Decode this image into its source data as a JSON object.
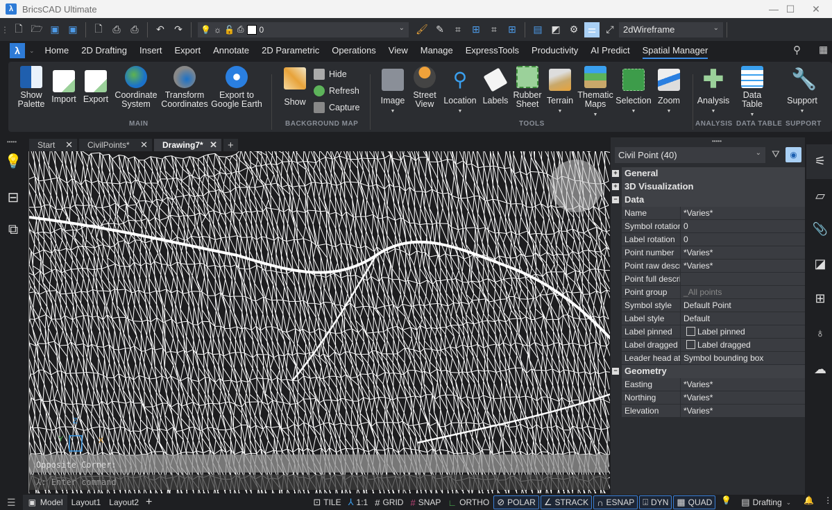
{
  "window": {
    "title": "BricsCAD Ultimate",
    "minimize": "—",
    "maximize": "☐",
    "close": "✕"
  },
  "qat": {
    "layer_value": "0",
    "visual_style": "2dWireframe"
  },
  "menu": {
    "app_button": "λ",
    "items": [
      "Home",
      "2D Drafting",
      "Insert",
      "Export",
      "Annotate",
      "2D Parametric",
      "Operations",
      "View",
      "Manage",
      "ExpressTools",
      "Productivity",
      "AI Predict",
      "Spatial Manager"
    ],
    "active": "Spatial Manager"
  },
  "ribbon": {
    "main": [
      {
        "label": "Show\nPalette",
        "icon": "spm-palette-icon"
      },
      {
        "label": "Import",
        "icon": "import-icon"
      },
      {
        "label": "Export",
        "icon": "export-icon"
      },
      {
        "label": "Coordinate\nSystem",
        "icon": "globe-icon"
      },
      {
        "label": "Transform\nCoordinates",
        "icon": "transform-globe-icon"
      },
      {
        "label": "Export to\nGoogle Earth",
        "icon": "google-earth-icon"
      }
    ],
    "background_map": {
      "show": "Show",
      "hide": "Hide",
      "refresh": "Refresh",
      "capture": "Capture"
    },
    "tools": [
      "Image",
      "Street\nView",
      "Location",
      "Labels",
      "Rubber\nSheet",
      "Terrain",
      "Thematic\nMaps",
      "Selection",
      "Zoom"
    ],
    "analysis": "Analysis",
    "data_table": "Data\nTable",
    "support": "Support",
    "groups": {
      "main": "MAIN",
      "background_map": "BACKGROUND MAP",
      "tools": "TOOLS",
      "analysis": "ANALYSIS",
      "data_table": "DATA TABLE",
      "support": "SUPPORT"
    }
  },
  "tabs": [
    {
      "label": "Start",
      "active": false
    },
    {
      "label": "CivilPoints*",
      "active": false
    },
    {
      "label": "Drawing7*",
      "active": true
    }
  ],
  "canvas": {
    "command_prompt": "Opposite Corner:",
    "command_input_placeholder": "Enter command",
    "ucs": {
      "x": "X",
      "y": "Y",
      "z": "Z"
    }
  },
  "properties": {
    "selection": "Civil Point (40)",
    "categories": {
      "general": "General",
      "visualization": "3D Visualization",
      "data": "Data",
      "geometry": "Geometry"
    },
    "data_rows": [
      {
        "key": "Name",
        "value": "*Varies*"
      },
      {
        "key": "Symbol rotation",
        "value": "0"
      },
      {
        "key": "Label rotation",
        "value": "0"
      },
      {
        "key": "Point number",
        "value": "*Varies*"
      },
      {
        "key": "Point raw description",
        "value": "*Varies*"
      },
      {
        "key": "Point full description",
        "value": ""
      },
      {
        "key": "Point group",
        "value": "_All points"
      },
      {
        "key": "Symbol style",
        "value": "Default Point"
      },
      {
        "key": "Label style",
        "value": "Default"
      },
      {
        "key": "Label pinned",
        "value": "Label pinned",
        "checkbox": true
      },
      {
        "key": "Label dragged",
        "value": "Label dragged",
        "checkbox": true
      },
      {
        "key": "Leader head at",
        "value": "Symbol bounding box"
      }
    ],
    "geometry_rows": [
      {
        "key": "Easting",
        "value": "*Varies*"
      },
      {
        "key": "Northing",
        "value": "*Varies*"
      },
      {
        "key": "Elevation",
        "value": "*Varies*"
      }
    ]
  },
  "statusbar": {
    "layouts": [
      "Model",
      "Layout1",
      "Layout2"
    ],
    "toggles": [
      {
        "label": "TILE",
        "on": false
      },
      {
        "label": "1:1",
        "on": false
      },
      {
        "label": "GRID",
        "on": false
      },
      {
        "label": "SNAP",
        "on": false
      },
      {
        "label": "ORTHO",
        "on": false
      },
      {
        "label": "POLAR",
        "on": true
      },
      {
        "label": "STRACK",
        "on": true
      },
      {
        "label": "ESNAP",
        "on": true
      },
      {
        "label": "DYN",
        "on": true
      },
      {
        "label": "QUAD",
        "on": true
      }
    ],
    "workspace": "Drafting"
  }
}
